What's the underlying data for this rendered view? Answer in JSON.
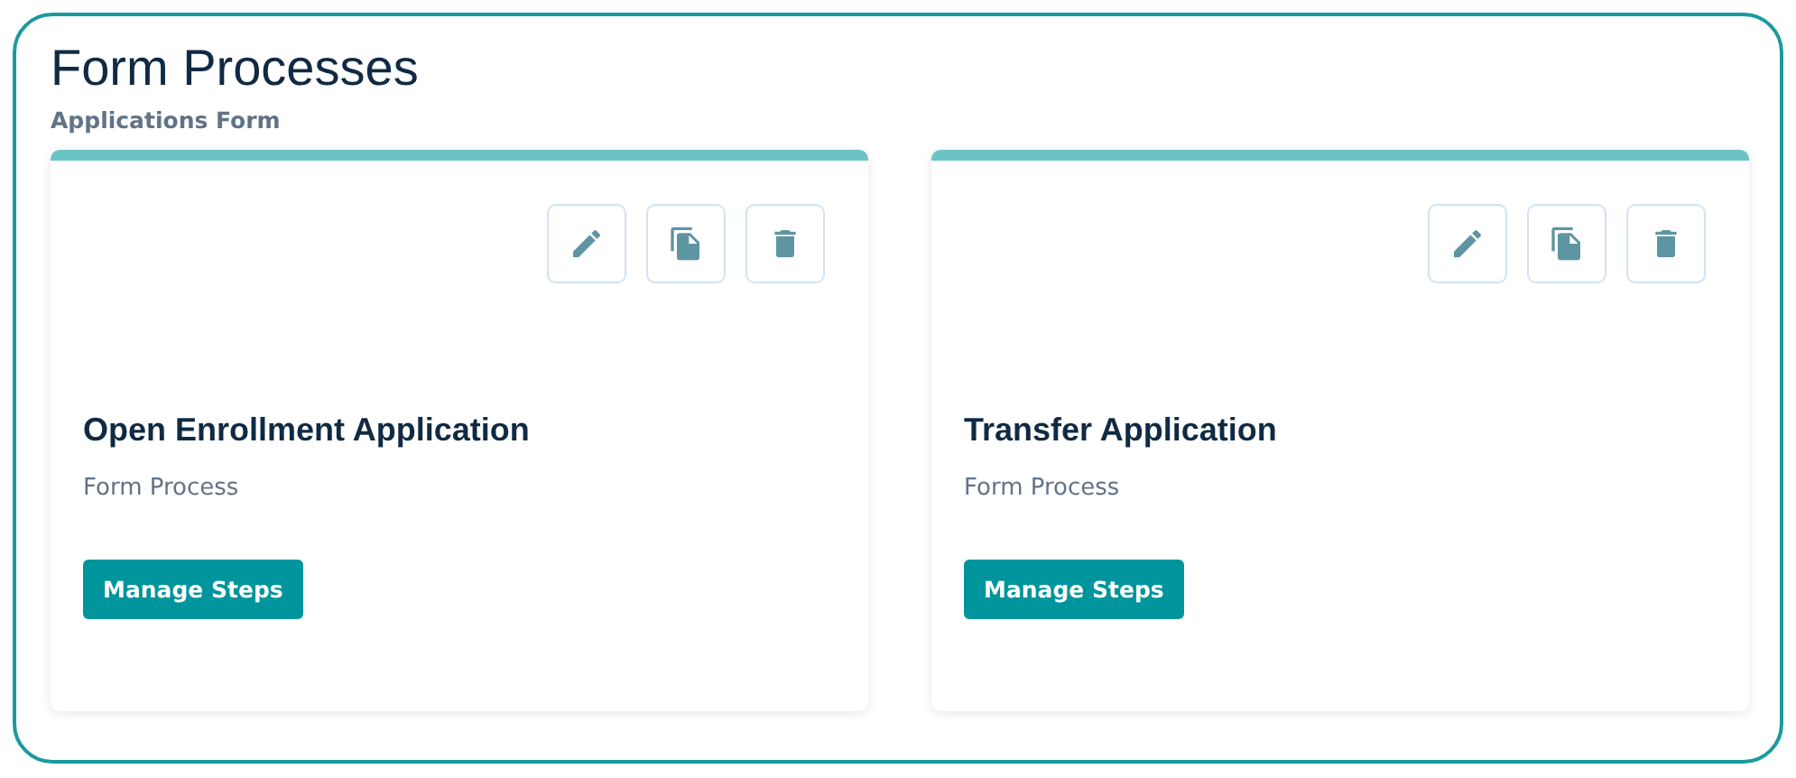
{
  "title": "Form Processes",
  "subtitle": "Applications Form",
  "cards": [
    {
      "name": "Open Enrollment Application",
      "type": "Form Process",
      "actions": [
        {
          "kind": "edit"
        },
        {
          "kind": "copy"
        },
        {
          "kind": "delete"
        }
      ],
      "button": "Manage Steps"
    },
    {
      "name": "Transfer Application",
      "type": "Form Process",
      "actions": [
        {
          "kind": "edit"
        },
        {
          "kind": "copy"
        },
        {
          "kind": "delete"
        }
      ],
      "button": "Manage Steps"
    }
  ]
}
